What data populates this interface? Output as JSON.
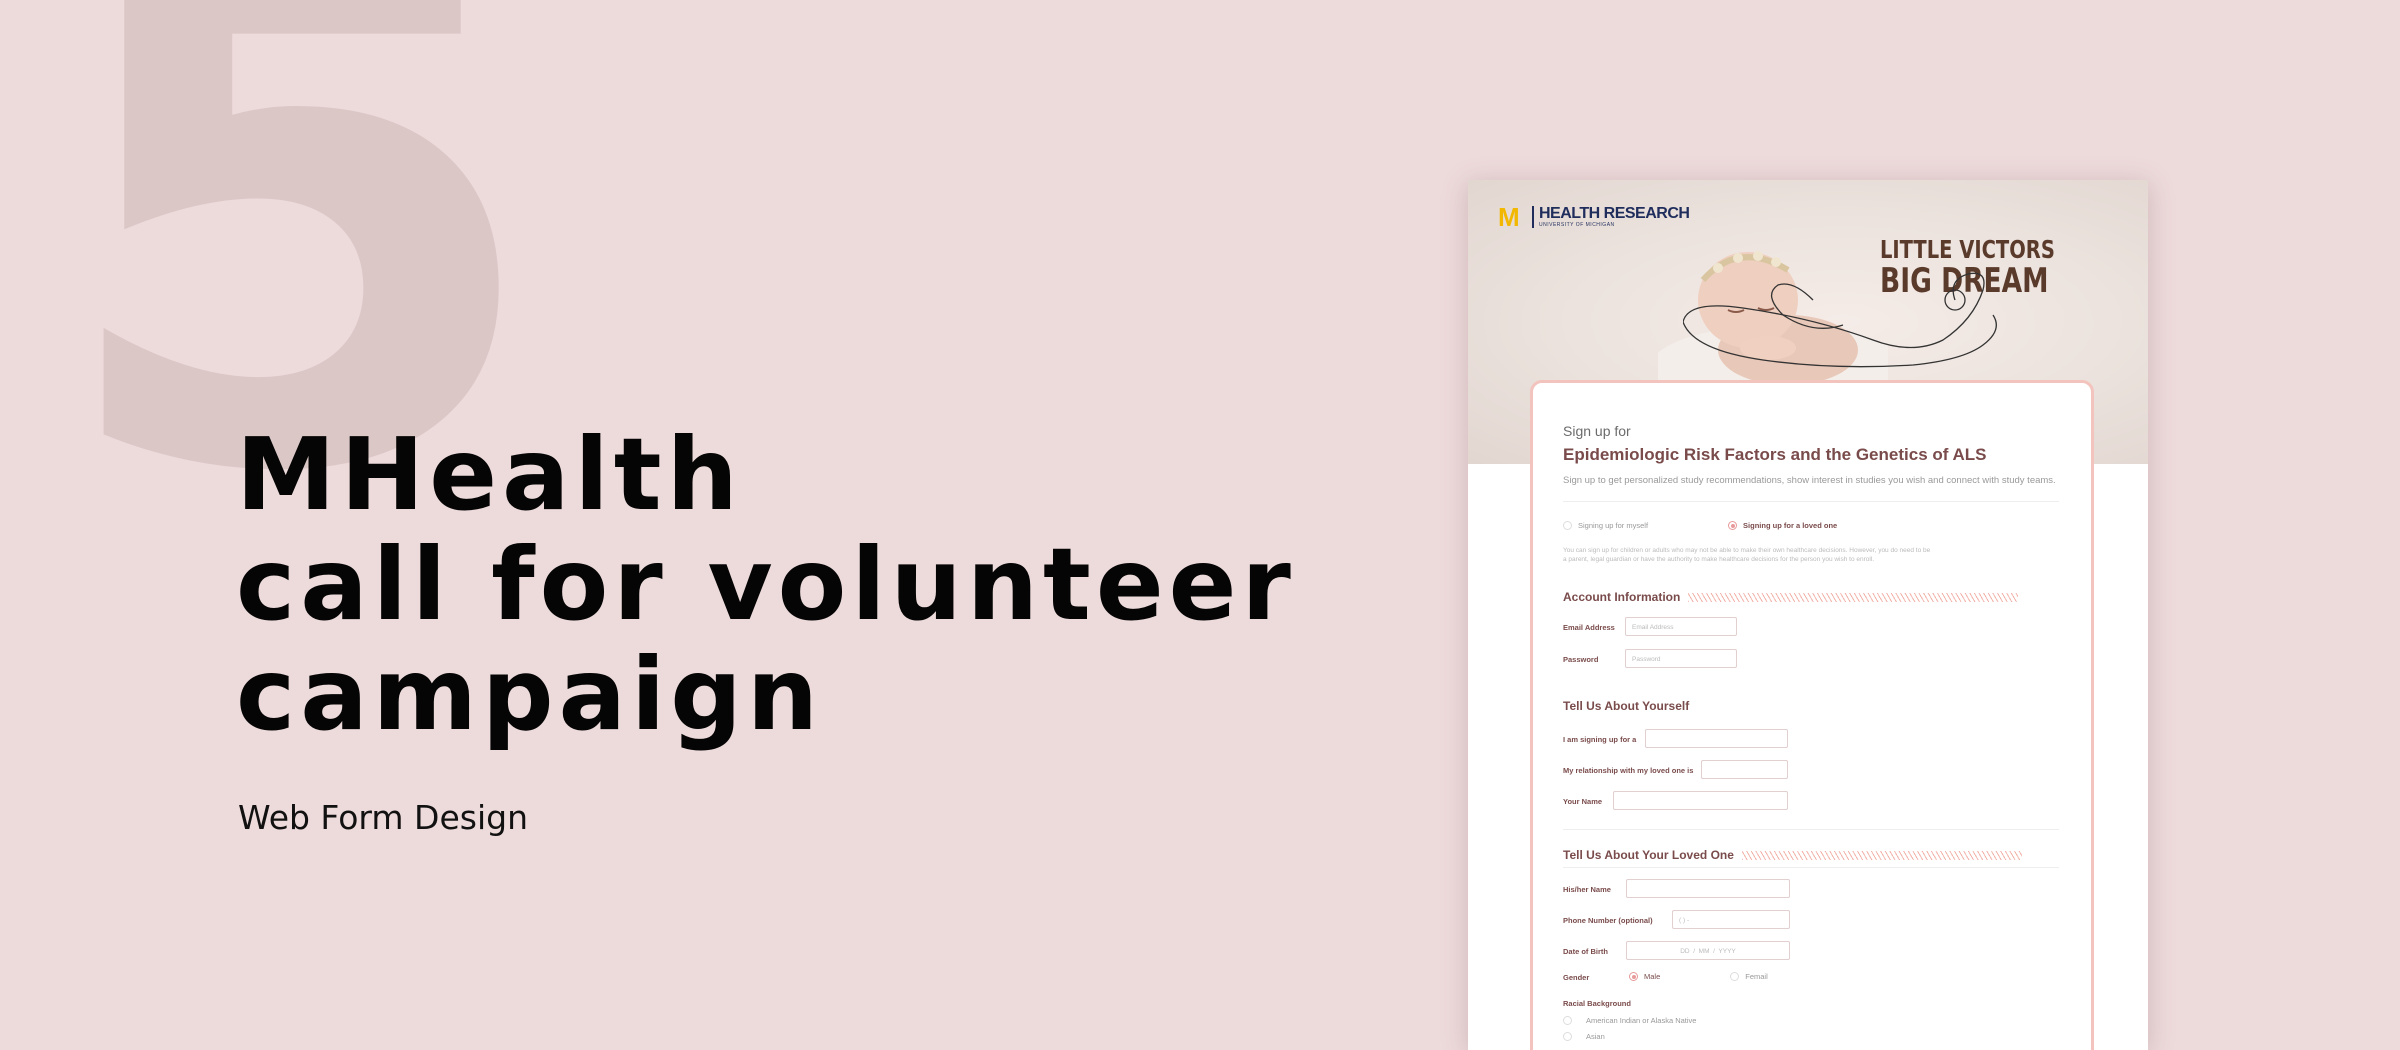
{
  "number": "5",
  "headline": [
    "MHealth",
    "call for volunteer",
    "campaign"
  ],
  "subtitle": "Web Form Design",
  "mockup": {
    "logo": {
      "title": "HEALTH RESEARCH",
      "sub": "UNIVERSITY OF MICHIGAN",
      "mark": "M"
    },
    "slogan": [
      "LITTLE VICTORS",
      "BIG DREAM"
    ],
    "signup_label": "Sign up for",
    "title": "Epidemiologic Risk Factors and the Genetics of ALS",
    "description": "Sign up to get personalized study recommendations, show interest in studies you wish and connect with study teams.",
    "radio_myself": "Signing up for myself",
    "radio_loved": "Signing up for a loved one",
    "note": "You can sign up for children or adults who may not be able to make their own healthcare decisions. However, you do need to be a parent, legal guardian or have the authority to make healthcare decisions for the person you wish to enroll.",
    "account": {
      "heading": "Account Information",
      "email_label": "Email Address",
      "email_placeholder": "Email Address",
      "password_label": "Password",
      "password_placeholder": "Password"
    },
    "yourself": {
      "heading": "Tell Us About Yourself",
      "signing_label": "I am signing up for a",
      "relationship_label": "My relationship with my loved one is",
      "name_label": "Your Name"
    },
    "loved_one": {
      "heading": "Tell Us About Your Loved One",
      "name_label": "His/her Name",
      "phone_label": "Phone Number (optional)",
      "phone_placeholder": "(        )          -",
      "dob_label": "Date of Birth",
      "dob_dd": "DD",
      "dob_mm": "MM",
      "dob_yyyy": "YYYY",
      "gender_label": "Gender",
      "male": "Male",
      "female": "Femail",
      "racial_label": "Racial Background",
      "racial_options": [
        "American Indian or Alaska Native",
        "Asian"
      ]
    }
  }
}
